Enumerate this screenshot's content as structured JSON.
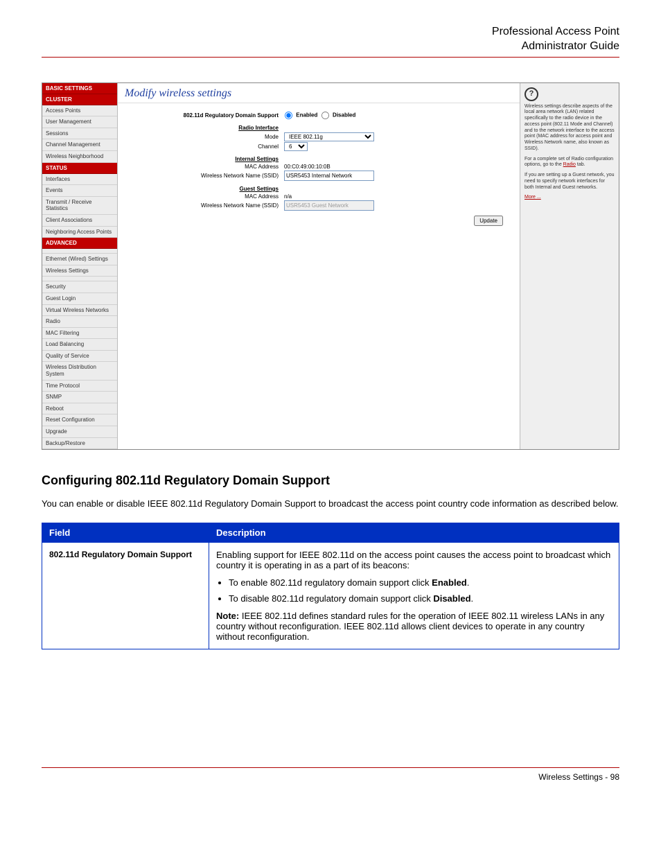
{
  "doc_header": {
    "line1": "Professional Access Point",
    "line2": "Administrator Guide"
  },
  "sidebar": {
    "basic": "BASIC SETTINGS",
    "cluster": "CLUSTER",
    "cluster_items": [
      "Access Points",
      "User Management",
      "Sessions",
      "Channel Management",
      "Wireless Neighborhood"
    ],
    "status": "STATUS",
    "status_items": [
      "Interfaces",
      "Events",
      "Transmit / Receive Statistics",
      "Client Associations",
      "Neighboring Access Points"
    ],
    "advanced": "ADVANCED",
    "advanced_items": [
      "Ethernet (Wired) Settings",
      "Wireless Settings",
      "Security",
      "Guest Login",
      "Virtual Wireless Networks",
      "Radio",
      "MAC Filtering",
      "Load Balancing",
      "Quality of Service",
      "Wireless Distribution System",
      "Time Protocol",
      "SNMP",
      "Reboot",
      "Reset Configuration",
      "Upgrade",
      "Backup/Restore"
    ]
  },
  "main": {
    "title": "Modify wireless settings",
    "labels": {
      "reg": "802.11d Regulatory Domain Support",
      "radio_interface": "Radio Interface",
      "mode": "Mode",
      "channel": "Channel",
      "internal": "Internal Settings",
      "mac": "MAC Address",
      "ssid": "Wireless Network Name (SSID)",
      "guest": "Guest Settings",
      "enabled": "Enabled",
      "disabled": "Disabled"
    },
    "values": {
      "mode": "IEEE 802.11g",
      "channel": "6",
      "internal_mac": "00:C0:49:00:10:0B",
      "internal_ssid": "USR5453 Internal Network",
      "guest_mac": "n/a",
      "guest_ssid": "USR5453 Guest Network"
    },
    "update": "Update"
  },
  "help": {
    "p1": "Wireless settings describe aspects of the local area network (LAN) related specifically to the radio device in the access point (802.11 Mode and Channel) and to the network interface to the access point (MAC address for access point and Wireless Network name, also known as SSID).",
    "p2a": "For a complete set of Radio configuration options, go to the ",
    "p2link": "Radio",
    "p2b": " tab.",
    "p3": "If you are setting up a Guest network, you need to specify network interfaces for both Internal and Guest networks.",
    "more": "More ..."
  },
  "section": {
    "heading": "Configuring 802.11d Regulatory Domain Support",
    "para": "You can enable or disable IEEE 802.11d Regulatory Domain Support to broadcast the access point country code information as described below."
  },
  "table": {
    "h1": "Field",
    "h2": "Description",
    "field": "802.11d Regulatory Domain Support",
    "d1": "Enabling support for IEEE 802.11d on the access point causes the access point to broadcast which country it is operating in as a part of its beacons:",
    "li1a": "To enable 802.11d regulatory domain support click ",
    "li1b": "Enabled",
    "li1c": ".",
    "li2a": "To disable 802.11d regulatory domain support click ",
    "li2b": "Disabled",
    "li2c": ".",
    "noteLabel": "Note:",
    "note": " IEEE 802.11d defines standard rules for the operation of IEEE 802.11 wireless LANs in any country without reconfiguration. IEEE 802.11d allows client devices to operate in any country without reconfiguration."
  },
  "footer": {
    "text": "Wireless Settings - 98"
  }
}
